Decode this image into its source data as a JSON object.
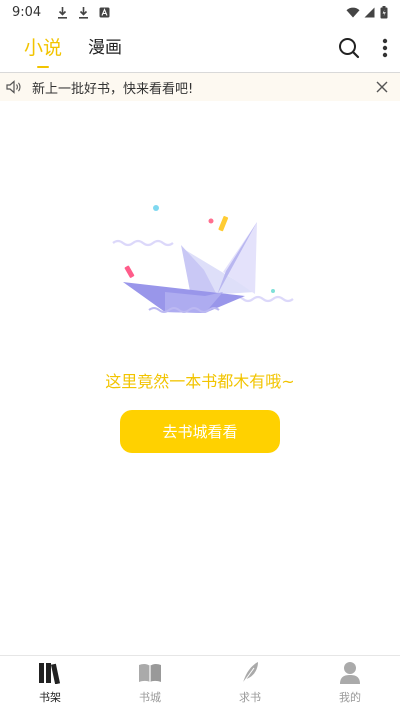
{
  "status_bar": {
    "time": "9:04",
    "left_icons": [
      "download-icon",
      "download-icon",
      "app-notification-icon"
    ],
    "right_icons": [
      "wifi-icon",
      "signal-icon",
      "battery-icon"
    ]
  },
  "top_tabs": [
    {
      "label": "小说",
      "active": true
    },
    {
      "label": "漫画",
      "active": false
    }
  ],
  "top_actions": [
    "search-icon",
    "more-vertical-icon"
  ],
  "notice": {
    "text": "新上一批好书，快来看看吧!",
    "icon": "speaker-icon",
    "close_icon": "close-icon"
  },
  "empty_state": {
    "message": "这里竟然一本书都木有哦~",
    "button_label": "去书城看看",
    "illustration": "paper-boat-illustration"
  },
  "bottom_nav": [
    {
      "label": "书架",
      "icon": "bookshelf-icon",
      "active": true
    },
    {
      "label": "书城",
      "icon": "open-book-icon",
      "active": false
    },
    {
      "label": "求书",
      "icon": "feather-icon",
      "active": false
    },
    {
      "label": "我的",
      "icon": "user-icon",
      "active": false
    }
  ],
  "colors": {
    "accent": "#f2c400",
    "button": "#ffd100",
    "notice_bg": "#fdf9f1",
    "inactive": "#999999"
  }
}
